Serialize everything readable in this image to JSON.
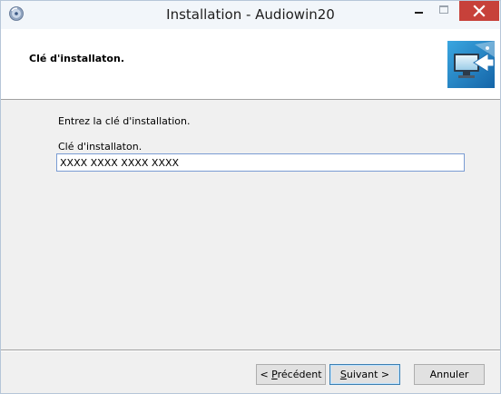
{
  "window": {
    "title": "Installation - Audiowin20",
    "colors": {
      "close_button": "#c7413a",
      "input_border": "#7a9cd3",
      "default_button_border": "#3c7fb1"
    }
  },
  "header": {
    "title": "Clé d'installaton."
  },
  "content": {
    "instruction": "Entrez la clé d'installation.",
    "field_label": "Clé d'installaton.",
    "key_value": "XXXX XXXX XXXX XXXX"
  },
  "buttons": {
    "prev_prefix": "< ",
    "prev_mnemonic": "P",
    "prev_rest": "récédent",
    "next_mnemonic": "S",
    "next_rest": "uivant >",
    "cancel": "Annuler"
  },
  "icons": {
    "app": "installer-cd-icon",
    "header_logo": "monitor-setup-icon",
    "minimize": "minimize-icon",
    "maximize": "maximize-icon",
    "close": "close-icon"
  }
}
